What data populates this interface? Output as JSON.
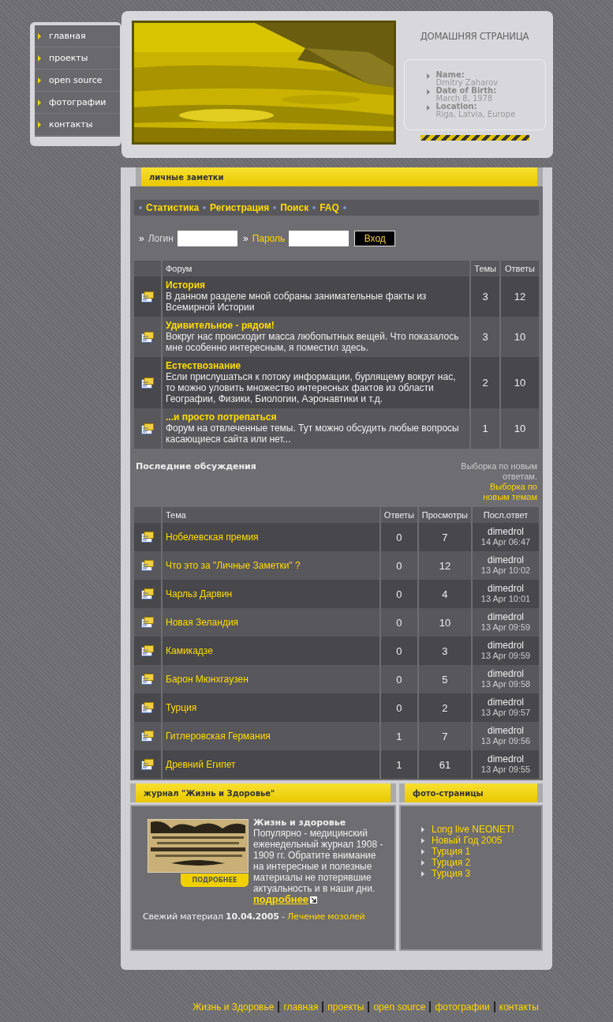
{
  "nav": [
    {
      "label": "главная"
    },
    {
      "label": "проекты"
    },
    {
      "label": "open source"
    },
    {
      "label": "фотографии"
    },
    {
      "label": "контакты"
    }
  ],
  "header": {
    "title": "ДОМАШНЯЯ СТРАНИЦА",
    "info": [
      {
        "label": "Name:",
        "value": "Dmitry Zaharov"
      },
      {
        "label": "Date of Birth:",
        "value": "March 8, 1978"
      },
      {
        "label": "Location:",
        "value": "Riga, Latvia, Europe"
      }
    ]
  },
  "main": {
    "title": "личные заметки",
    "links": [
      "Статистика",
      "Регистрация",
      "Поиск",
      "FAQ"
    ],
    "login": {
      "fields": [
        {
          "mark": "»",
          "label": "Логин",
          "kind": "plain"
        },
        {
          "mark": "»",
          "label": "Пароль",
          "kind": "link"
        }
      ],
      "button": "Вход"
    },
    "forums": {
      "columns": [
        "Форум",
        "Темы",
        "Ответы"
      ],
      "rows": [
        {
          "title": "История",
          "description": "В данном разделе мной собраны занимательные факты из Всемирной Истории",
          "topics": "3",
          "replies": "12"
        },
        {
          "title": "Удивительное - рядом!",
          "description": "Вокруг нас происходит масса любопытных вещей. Что показалось мне особенно интересным, я поместил здесь.",
          "topics": "3",
          "replies": "10"
        },
        {
          "title": "Естествознание",
          "description": "Если прислушаться к потоку информации, бурлящему вокруг нас, то можно уловить множество интересных фактов из области Географии, Физики, Биологии, Аэронавтики и т.д.",
          "topics": "2",
          "replies": "10"
        },
        {
          "title": "...и просто потрепаться",
          "description": "Форум на отвлеченные темы. Тут можно обсудить любые вопросы касающиеся сайта или нет...",
          "topics": "1",
          "replies": "10"
        }
      ]
    },
    "latest": {
      "title": "Последние обсуждения",
      "filter_text": "Выборка по новым ответам.",
      "filter_link": "Выборка по новым темам",
      "columns": [
        "Тема",
        "Ответы",
        "Просмотры",
        "Посл.ответ"
      ],
      "rows": [
        {
          "topic": "Нобелевская премия",
          "replies": "0",
          "views": "7",
          "author": "dimedrol",
          "time": "14 Apr 06:47"
        },
        {
          "topic": "Что это за \"Личные Заметки\" ?",
          "replies": "0",
          "views": "12",
          "author": "dimedrol",
          "time": "13 Apr 10:02"
        },
        {
          "topic": "Чарльз Дарвин",
          "replies": "0",
          "views": "4",
          "author": "dimedrol",
          "time": "13 Apr 10:01"
        },
        {
          "topic": "Новая Зеландия",
          "replies": "0",
          "views": "10",
          "author": "dimedrol",
          "time": "13 Apr 09:59"
        },
        {
          "topic": "Камикадзе",
          "replies": "0",
          "views": "3",
          "author": "dimedrol",
          "time": "13 Apr 09:59"
        },
        {
          "topic": "Барон Мюнхгаузен",
          "replies": "0",
          "views": "5",
          "author": "dimedrol",
          "time": "13 Apr 09:58"
        },
        {
          "topic": "Турция",
          "replies": "0",
          "views": "2",
          "author": "dimedrol",
          "time": "13 Apr 09:57"
        },
        {
          "topic": "Гитлеровская Германия",
          "replies": "1",
          "views": "7",
          "author": "dimedrol",
          "time": "13 Apr 09:56"
        },
        {
          "topic": "Древний Египет",
          "replies": "1",
          "views": "61",
          "author": "dimedrol",
          "time": "13 Apr 09:55"
        }
      ]
    }
  },
  "journal": {
    "title": "журнал \"Жизнь и Здоровье\"",
    "more_button": "ПОДРОБНЕЕ",
    "heading": "Жизнь и здоровье",
    "text": "Популярно - медицинский еженедельный журнал 1908 - 1909 гг. Обратите внимание на интересные и полезные материалы не потерявшие актуальность и в наши дни.",
    "more_link": "подробнее",
    "fresh_text": "Свежий материал **10.04.2005** -",
    "fresh_link": "Лечение мозолей"
  },
  "photos": {
    "title": "фото-страницы",
    "items": [
      "Long live NEONET!",
      "Новый Год 2005",
      "Турция 1",
      "Турция 2",
      "Турция 3"
    ]
  },
  "footer": [
    "Жизнь и Здоровье",
    "главная",
    "проекты",
    "open source",
    "фотографии",
    "контакты"
  ]
}
